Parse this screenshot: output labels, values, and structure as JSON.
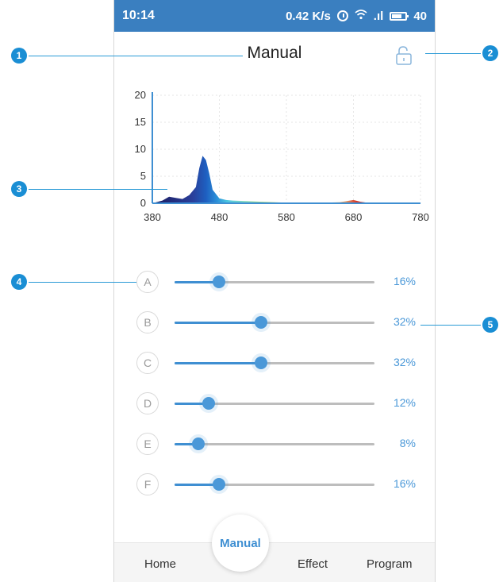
{
  "status_bar": {
    "time": "10:14",
    "network_speed": "0.42 K/s",
    "signal": ".ıl",
    "battery": "40"
  },
  "header": {
    "title": "Manual"
  },
  "chart_data": {
    "type": "area",
    "x_ticks": [
      "380",
      "480",
      "580",
      "680",
      "780"
    ],
    "y_ticks": [
      "20",
      "15",
      "10",
      "5",
      "0"
    ],
    "xlim": [
      380,
      780
    ],
    "ylim": [
      0,
      20
    ],
    "grid": true,
    "series": [
      {
        "x": [
          380,
          395,
          405,
          415,
          425,
          435,
          445,
          450,
          455,
          460,
          465,
          470,
          480,
          490,
          500,
          520,
          540,
          560,
          580,
          600,
          620,
          640,
          660,
          670,
          680,
          690,
          700,
          720,
          780
        ],
        "values": [
          0,
          0.5,
          1.2,
          1.0,
          0.8,
          1.5,
          3.0,
          6.5,
          8.8,
          8.0,
          5.5,
          2.5,
          0.9,
          0.6,
          0.5,
          0.4,
          0.3,
          0.2,
          0.1,
          0.1,
          0.1,
          0.1,
          0.2,
          0.4,
          0.6,
          0.3,
          0.1,
          0,
          0
        ]
      }
    ]
  },
  "channels": [
    {
      "label": "A",
      "value": 0.16,
      "percent": "16%"
    },
    {
      "label": "B",
      "value": 0.32,
      "percent": "32%"
    },
    {
      "label": "C",
      "value": 0.32,
      "percent": "32%"
    },
    {
      "label": "D",
      "value": 0.12,
      "percent": "12%"
    },
    {
      "label": "E",
      "value": 0.08,
      "percent": "8%"
    },
    {
      "label": "F",
      "value": 0.16,
      "percent": "16%"
    }
  ],
  "bottom_nav": {
    "home": "Home",
    "manual": "Manual",
    "effect": "Effect",
    "program": "Program"
  },
  "callouts": [
    "1",
    "2",
    "3",
    "4",
    "5"
  ],
  "colors": {
    "accent": "#3f8fd2",
    "status_bar": "#3a7fc0",
    "callout": "#1a8ed4"
  }
}
